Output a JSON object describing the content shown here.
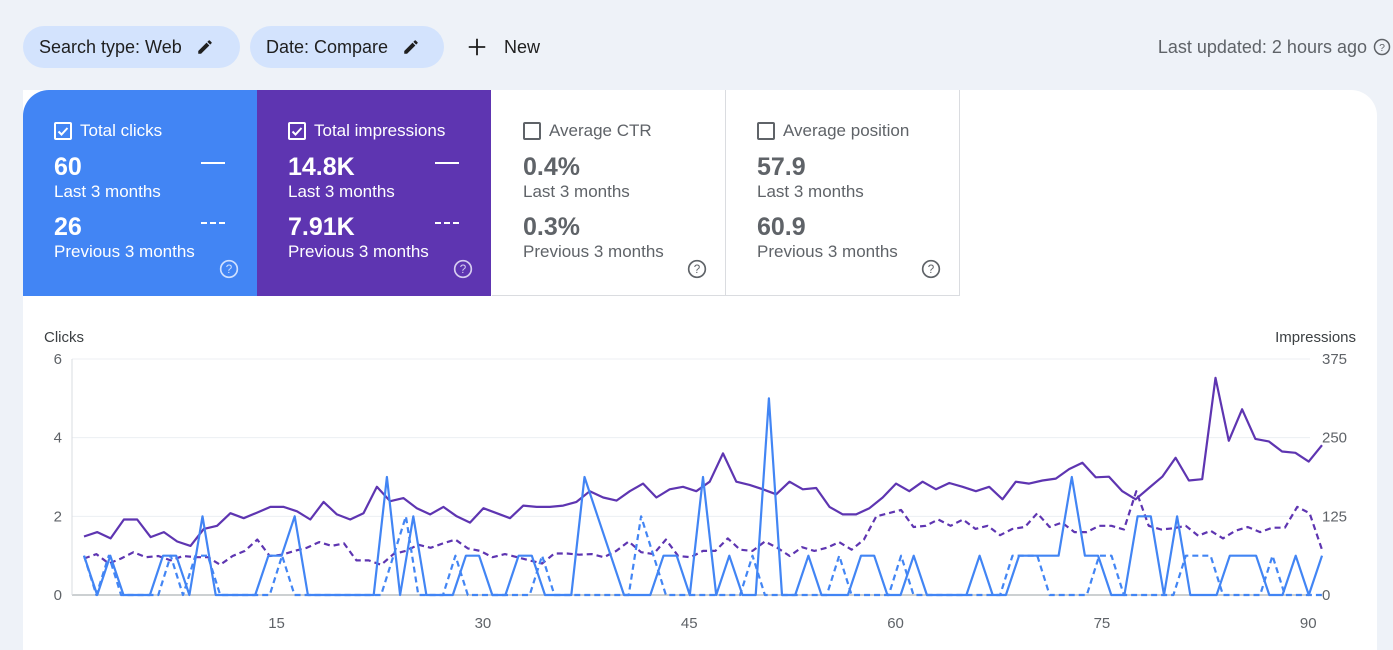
{
  "toolbar": {
    "search_type_label": "Search type: Web",
    "date_label": "Date: Compare",
    "new_label": "New",
    "last_updated": "Last updated: 2 hours ago"
  },
  "metrics": [
    {
      "title": "Total clicks",
      "checked": true,
      "value": "60",
      "period": "Last 3 months",
      "prev_value": "26",
      "prev_period": "Previous 3 months",
      "color": "#4285f4"
    },
    {
      "title": "Total impressions",
      "checked": true,
      "value": "14.8K",
      "period": "Last 3 months",
      "prev_value": "7.91K",
      "prev_period": "Previous 3 months",
      "color": "#5e35b1"
    },
    {
      "title": "Average CTR",
      "checked": false,
      "value": "0.4%",
      "period": "Last 3 months",
      "prev_value": "0.3%",
      "prev_period": "Previous 3 months"
    },
    {
      "title": "Average position",
      "checked": false,
      "value": "57.9",
      "period": "Last 3 months",
      "prev_value": "60.9",
      "prev_period": "Previous 3 months"
    }
  ],
  "chart_data": {
    "type": "line",
    "ylabel_left": "Clicks",
    "ylabel_right": "Impressions",
    "ylim_left": [
      0,
      6
    ],
    "ylim_right": [
      0,
      375
    ],
    "yticks_left": [
      "0",
      "2",
      "4",
      "6"
    ],
    "yticks_right": [
      "0",
      "125",
      "250",
      "375"
    ],
    "xticks": [
      15,
      30,
      45,
      60,
      75,
      90
    ],
    "x_range": [
      1,
      91
    ],
    "grid": true,
    "series": [
      {
        "axis": "right",
        "style": "solid",
        "color": "#5e35b1",
        "values": [
          93,
          100,
          90,
          120,
          120,
          92,
          100,
          85,
          78,
          105,
          110,
          130,
          122,
          131,
          140,
          140,
          133,
          120,
          148,
          128,
          120,
          130,
          172,
          149,
          154,
          138,
          128,
          140,
          125,
          115,
          138,
          130,
          122,
          142,
          140,
          140,
          142,
          148,
          165,
          155,
          150,
          165,
          177,
          155,
          168,
          172,
          165,
          180,
          225,
          180,
          175,
          168,
          160,
          180,
          168,
          170,
          140,
          128,
          128,
          138,
          155,
          177,
          165,
          180,
          168,
          178,
          172,
          165,
          172,
          152,
          180,
          177,
          182,
          185,
          200,
          210,
          187,
          188,
          165,
          152,
          170,
          188,
          218,
          182,
          184,
          345,
          245,
          295,
          248,
          244,
          228,
          226,
          212,
          238
        ]
      },
      {
        "axis": "right",
        "style": "dashed",
        "color": "#5e35b1",
        "values": [
          58,
          65,
          50,
          58,
          68,
          60,
          62,
          55,
          62,
          60,
          60,
          48,
          62,
          70,
          88,
          62,
          64,
          70,
          75,
          84,
          78,
          82,
          55,
          55,
          48,
          65,
          70,
          80,
          75,
          82,
          88,
          74,
          70,
          60,
          65,
          60,
          55,
          50,
          66,
          66,
          64,
          65,
          60,
          70,
          85,
          68,
          65,
          88,
          62,
          60,
          70,
          70,
          90,
          72,
          70,
          85,
          75,
          62,
          76,
          70,
          75,
          84,
          72,
          88,
          125,
          130,
          135,
          108,
          110,
          120,
          110,
          120,
          105,
          110,
          95,
          105,
          108,
          130,
          108,
          115,
          100,
          100,
          110,
          110,
          104,
          165,
          110,
          104,
          106,
          110,
          94,
          102,
          90,
          102,
          108,
          100,
          107,
          107,
          140,
          130,
          72
        ]
      },
      {
        "axis": "left",
        "style": "solid",
        "color": "#4285f4",
        "values": [
          1,
          0,
          1,
          0,
          0,
          0,
          1,
          1,
          0,
          2,
          0,
          0,
          0,
          0,
          1,
          1,
          2,
          0,
          0,
          0,
          0,
          0,
          0,
          3,
          0,
          2,
          0,
          0,
          0,
          1,
          1,
          0,
          0,
          1,
          1,
          0,
          0,
          0,
          3,
          2,
          1,
          0,
          0,
          0,
          1,
          1,
          0,
          3,
          0,
          1,
          0,
          0,
          5,
          0,
          0,
          1,
          0,
          0,
          0,
          1,
          1,
          0,
          0,
          1,
          0,
          0,
          0,
          0,
          1,
          0,
          0,
          1,
          1,
          1,
          1,
          3,
          1,
          1,
          0,
          0,
          2,
          2,
          0,
          2,
          0,
          0,
          0,
          1,
          1,
          1,
          0,
          0,
          1,
          0,
          1
        ]
      },
      {
        "axis": "left",
        "style": "dashed",
        "color": "#4285f4",
        "values": [
          1,
          0,
          1,
          0,
          0,
          0,
          0,
          1,
          0,
          1,
          1,
          0,
          0,
          0,
          0,
          0,
          1,
          0,
          0,
          0,
          0,
          0,
          0,
          0,
          0,
          1,
          2,
          0,
          0,
          0,
          1,
          0,
          0,
          0,
          0,
          0,
          0,
          1,
          0,
          0,
          0,
          0,
          0,
          0,
          0,
          2,
          1,
          0,
          0,
          0,
          0,
          0,
          0,
          0,
          1,
          0,
          0,
          0,
          0,
          0,
          0,
          1,
          0,
          0,
          0,
          0,
          1,
          0,
          0,
          0,
          0,
          0,
          0,
          0,
          0,
          1,
          1,
          1,
          0,
          0,
          0,
          0,
          1,
          1,
          0,
          0,
          0,
          0,
          0,
          1,
          1,
          1,
          0,
          0,
          0,
          0,
          1,
          0,
          0,
          0,
          0
        ]
      }
    ]
  }
}
